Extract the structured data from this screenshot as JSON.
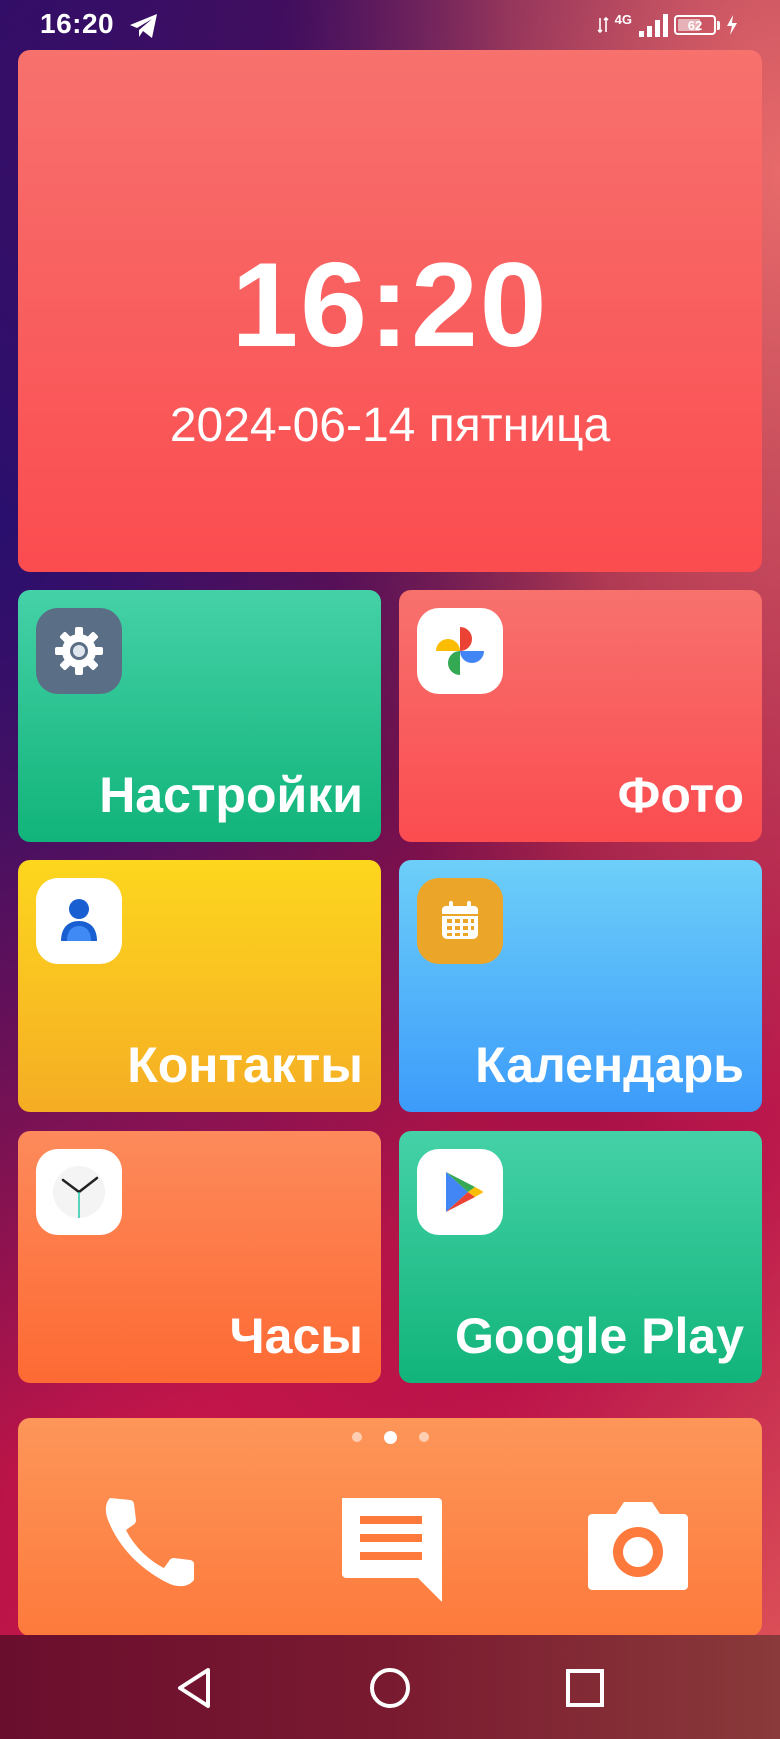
{
  "status_bar": {
    "time": "16:20",
    "network": "4G",
    "battery_level": "62",
    "icons": [
      "telegram-icon",
      "data-arrows-icon",
      "signal-icon",
      "battery-icon",
      "charging-icon"
    ]
  },
  "clock_widget": {
    "time": "16:20",
    "date": "2024-06-14 пятница"
  },
  "apps": [
    {
      "label": "Настройки",
      "icon": "gear-icon"
    },
    {
      "label": "Фото",
      "icon": "pinwheel-icon"
    },
    {
      "label": "Контакты",
      "icon": "person-icon"
    },
    {
      "label": "Календарь",
      "icon": "calendar-icon"
    },
    {
      "label": "Часы",
      "icon": "clock-icon"
    },
    {
      "label": "Google Play",
      "icon": "play-store-icon"
    }
  ],
  "dock": {
    "pages": 3,
    "active_page": 2,
    "items": [
      "phone-icon",
      "message-icon",
      "camera-icon"
    ]
  },
  "nav": {
    "items": [
      "back-icon",
      "home-icon",
      "recents-icon"
    ]
  },
  "colors": {
    "red_tile": "#fb4c50",
    "green_tile": "#11b47a",
    "yellow_tile": "#f5ad24",
    "blue_tile": "#3c9bfa",
    "orange_tile": "#fd6a33",
    "dock": "#fd7a3c",
    "settings_icon_bg": "#5a6f86",
    "calendar_icon_bg": "#eba62a"
  }
}
